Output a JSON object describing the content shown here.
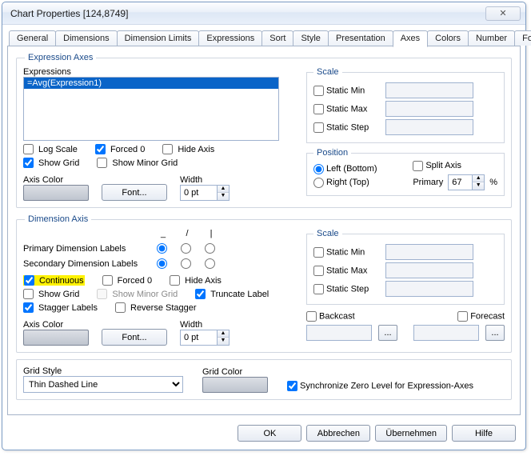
{
  "window": {
    "title": "Chart Properties [124,8749]",
    "close_glyph": "✕"
  },
  "tabs": {
    "items": [
      "General",
      "Dimensions",
      "Dimension Limits",
      "Expressions",
      "Sort",
      "Style",
      "Presentation",
      "Axes",
      "Colors",
      "Number",
      "Font"
    ],
    "active_index": 7,
    "nav_left": "◄",
    "nav_right": "►"
  },
  "expr_axes": {
    "legend": "Expression Axes",
    "expressions_label": "Expressions",
    "list": [
      "=Avg(Expression1)"
    ],
    "log_scale": "Log Scale",
    "forced0": "Forced 0",
    "hide_axis": "Hide Axis",
    "show_grid": "Show Grid",
    "show_minor_grid": "Show Minor Grid",
    "axis_color_label": "Axis Color",
    "font_btn": "Font...",
    "width_label": "Width",
    "width_value": "0 pt",
    "scale": {
      "legend": "Scale",
      "static_min": "Static Min",
      "static_max": "Static Max",
      "static_step": "Static Step"
    },
    "position": {
      "legend": "Position",
      "left": "Left (Bottom)",
      "right": "Right (Top)",
      "split_axis": "Split Axis",
      "primary_label": "Primary",
      "primary_value": "67",
      "percent": "%"
    }
  },
  "dim_axis": {
    "legend": "Dimension Axis",
    "col_headers": [
      "_",
      "/",
      "|"
    ],
    "primary_label": "Primary Dimension Labels",
    "secondary_label": "Secondary Dimension Labels",
    "continuous": "Continuous",
    "forced0": "Forced 0",
    "hide_axis": "Hide Axis",
    "show_grid": "Show Grid",
    "show_minor_grid": "Show Minor Grid",
    "truncate_label": "Truncate Label",
    "stagger_labels": "Stagger Labels",
    "reverse_stagger": "Reverse Stagger",
    "axis_color_label": "Axis Color",
    "font_btn": "Font...",
    "width_label": "Width",
    "width_value": "0 pt",
    "scale": {
      "legend": "Scale",
      "static_min": "Static Min",
      "static_max": "Static Max",
      "static_step": "Static Step"
    },
    "backcast": "Backcast",
    "forecast": "Forecast"
  },
  "grid": {
    "style_label": "Grid Style",
    "style_value": "Thin Dashed Line",
    "color_label": "Grid Color",
    "sync_label": "Synchronize Zero Level for Expression-Axes"
  },
  "buttons": {
    "ok": "OK",
    "cancel": "Abbrechen",
    "apply": "Übernehmen",
    "help": "Hilfe"
  }
}
